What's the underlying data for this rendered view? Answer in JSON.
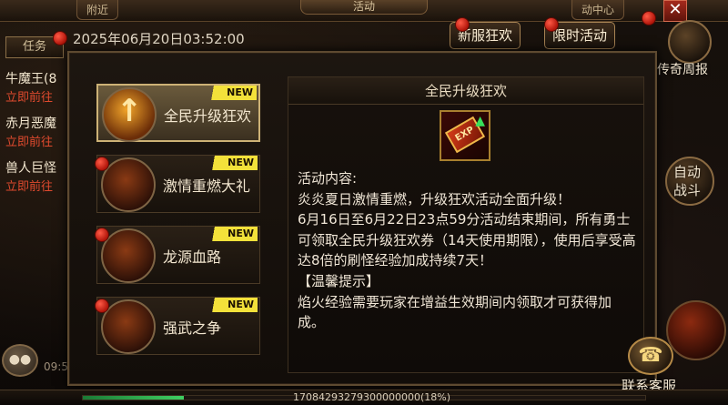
{
  "timestamp": "2025年06月20日03:52:00",
  "top_bar": {
    "left_tab": "附近",
    "center_tab": "活动",
    "right_partial": "动中心"
  },
  "quest_panel": {
    "tab_label": "任务",
    "items": [
      {
        "name": "牛魔王(8",
        "action": "立即前往"
      },
      {
        "name": "赤月恶魔",
        "action": "立即前往"
      },
      {
        "name": "兽人巨怪",
        "action": "立即前往"
      }
    ],
    "chat_icon": "chat-bubble-icon",
    "small_time": "09:5"
  },
  "header_buttons": {
    "new_server": "新服狂欢",
    "limited_event": "限时活动"
  },
  "side_buttons": {
    "weekly": "传奇周报",
    "auto_battle_line1": "自动",
    "auto_battle_line2": "战斗",
    "customer_service": "联系客服"
  },
  "menu": {
    "items": [
      {
        "label": "全民升级狂欢",
        "tag": "NEW",
        "active": true
      },
      {
        "label": "激情重燃大礼",
        "tag": "NEW",
        "active": false
      },
      {
        "label": "龙源血路",
        "tag": "NEW",
        "active": false
      },
      {
        "label": "强武之争",
        "tag": "NEW",
        "active": false
      }
    ]
  },
  "content": {
    "title": "全民升级狂欢",
    "icon": "exp-ticket-icon",
    "icon_text": "EXP",
    "text": "活动内容:\n炎炎夏日激情重燃，升级狂欢活动全面升级！\n6月16日至6月22日23点59分活动结束期间，所有勇士可领取全民升级狂欢券（14天使用期限），使用后享受高达8倍的刷怪经验加成持续7天！\n【温馨提示】\n焰火经验需要玩家在增益生效期间内领取才可获得加成。"
  },
  "exp_bar": {
    "text": "17084293279300000000(18%)",
    "fill_percent": 18
  },
  "colors": {
    "accent_gold": "#cdb276",
    "notification_red": "#e0291a",
    "quest_action_red": "#e04a2e",
    "new_tag_yellow": "#f3e13a"
  }
}
